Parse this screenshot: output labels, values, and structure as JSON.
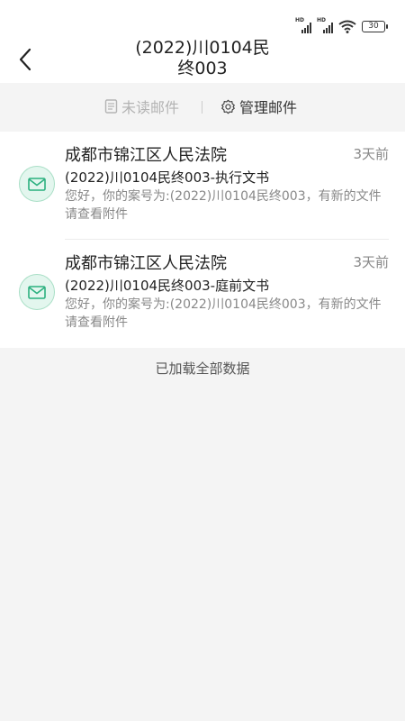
{
  "status_bar": {
    "battery": "30",
    "signal1_badge": "HD",
    "signal2_badge": "HD",
    "icons": [
      "signal-hd-icon",
      "signal-hd-icon",
      "wifi-icon",
      "battery-icon"
    ]
  },
  "header": {
    "back_icon": "chevron-left-icon",
    "title_line1": "(2022)川0104民",
    "title_line2": "终003"
  },
  "toolbar": {
    "unread_label": "未读邮件",
    "unread_icon": "document-icon",
    "manage_label": "管理邮件",
    "manage_icon": "gear-icon"
  },
  "mails": [
    {
      "sender": "成都市锦江区人民法院",
      "time": "3天前",
      "subject": "(2022)川0104民终003-执行文书",
      "preview": "您好，你的案号为:(2022)川0104民终003，有新的文件请查看附件",
      "icon": "envelope-icon"
    },
    {
      "sender": "成都市锦江区人民法院",
      "time": "3天前",
      "subject": "(2022)川0104民终003-庭前文书",
      "preview": "您好，你的案号为:(2022)川0104民终003，有新的文件请查看附件",
      "icon": "envelope-icon"
    }
  ],
  "footer": {
    "note": "已加载全部数据"
  },
  "colors": {
    "accent_green": "#2bb07f",
    "envelope_bg": "#e3f6ee",
    "page_bg": "#f4f4f4",
    "muted_text": "#888888"
  }
}
